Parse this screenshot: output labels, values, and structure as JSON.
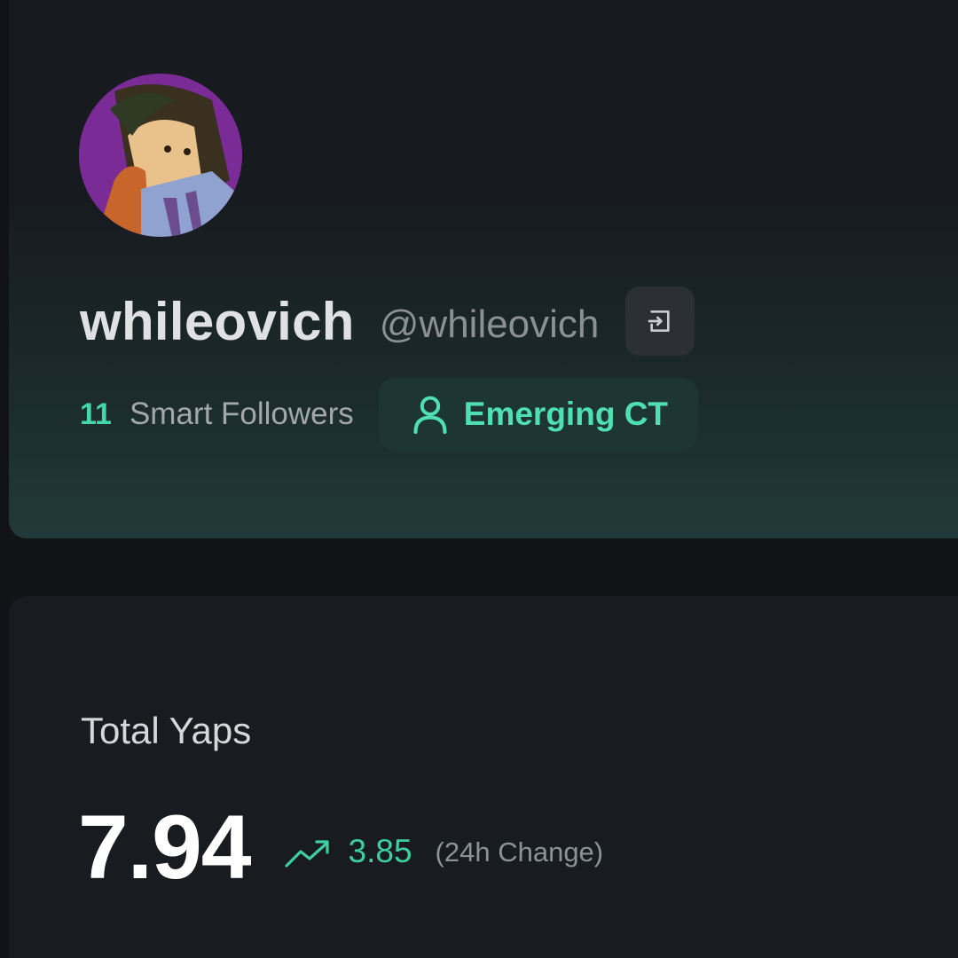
{
  "profile": {
    "display_name": "whileovich",
    "handle": "@whileovich",
    "avatar_icon": "anime-character-avatar",
    "copy_icon": "login-arrow-icon",
    "smart_followers_count": "11",
    "smart_followers_label": "Smart Followers",
    "tier_icon": "user-icon",
    "tier_label": "Emerging CT"
  },
  "stats": {
    "title": "Total Yaps",
    "total_value": "7.94",
    "trend_icon": "trending-up-icon",
    "change_value": "3.85",
    "change_label": "(24h Change)"
  },
  "colors": {
    "background": "#111317",
    "card": "#181b20",
    "accent_green": "#45d6aa",
    "avatar_bg": "#7b2b96"
  }
}
